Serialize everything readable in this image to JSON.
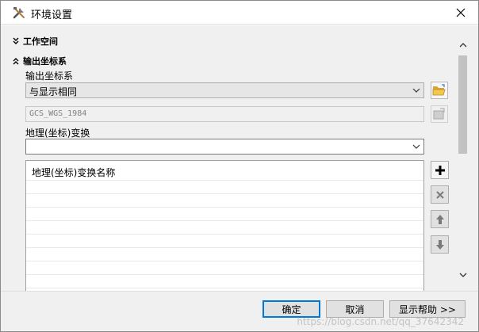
{
  "window": {
    "title": "环境设置",
    "icon": "tools-icon"
  },
  "sections": {
    "workspace": {
      "label": "工作空间",
      "state": "collapsed"
    },
    "output_cs": {
      "label": "输出坐标系",
      "state": "expanded"
    }
  },
  "output_coordinate_system": {
    "label": "输出坐标系",
    "selected": "与显示相同",
    "readonly_value": "GCS_WGS_1984"
  },
  "geo_transform": {
    "label": "地理(坐标)变换",
    "selected": "",
    "grid_header": "地理(坐标)变换名称"
  },
  "buttons": {
    "ok": "确定",
    "cancel": "取消",
    "help": "显示帮助 >>"
  },
  "watermark": "https://blog.csdn.net/qq_37642342",
  "colors": {
    "accent": "#0078d7",
    "folder": "#e8b53a"
  }
}
